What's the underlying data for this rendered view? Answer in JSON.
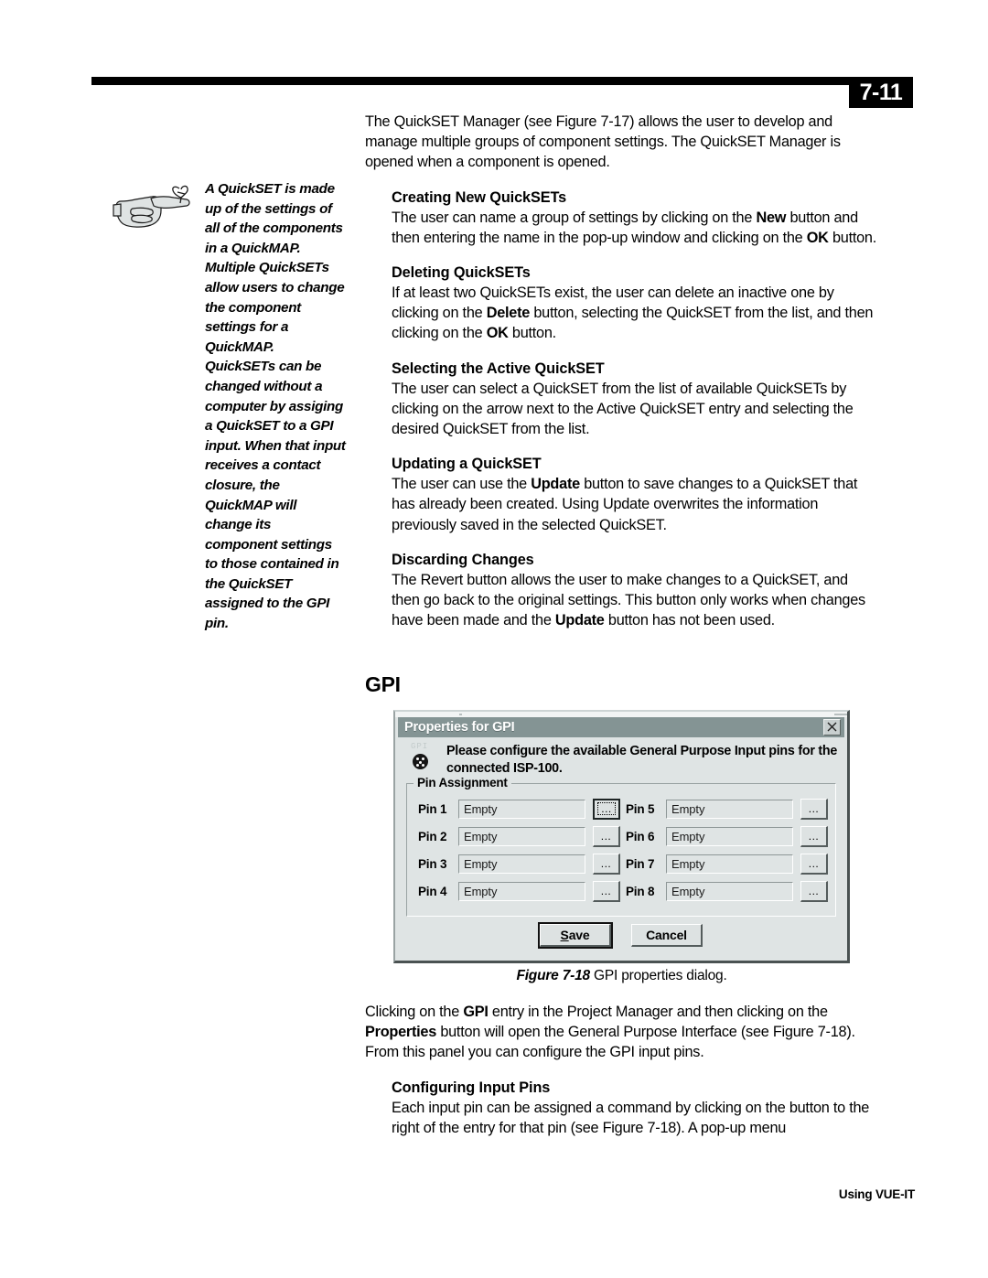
{
  "page": {
    "badge": "7-11",
    "footer": "Using VUE-IT"
  },
  "intro": {
    "paragraph": "The QuickSET Manager (see Figure 7-17) allows the user to develop and manage multiple groups of component settings. The QuickSET Manager is opened when a component is opened."
  },
  "note": {
    "icon": "pointing-hand-icon",
    "text": "A QuickSET is made up of the settings of all of the components in a QuickMAP. Multiple QuickSETs allow users to change the component settings for a QuickMAP. QuickSETs can be changed without a computer by assiging a QuickSET to a GPI input. When that input receives a contact closure, the QuickMAP will change its component settings to those contained in the QuickSET assigned to the GPI pin."
  },
  "sections": [
    {
      "heading": "Creating New QuickSETs",
      "body_html": "The user can name a group of settings by clicking on the <b>New</b> button and then entering the name in the pop-up window and clicking on the <b>OK</b> button."
    },
    {
      "heading": "Deleting QuickSETs",
      "body_html": "If at least two QuickSETs exist, the user can delete an inactive one by clicking on the <b>Delete</b> button, selecting the QuickSET from the list, and then clicking on the <b>OK</b> button."
    },
    {
      "heading": "Selecting the Active QuickSET",
      "body_html": "The user can select a QuickSET from the list of available QuickSETs by clicking on the arrow next to the Active QuickSET entry and selecting the desired QuickSET from the list."
    },
    {
      "heading": "Updating a QuickSET",
      "body_html": "The user can use the <b>Update</b> button to save changes to a QuickSET that has already been created. Using Update overwrites the information previously saved in the selected QuickSET."
    },
    {
      "heading": "Discarding Changes",
      "body_html": "The Revert button allows the user to make changes to a QuickSET, and then go back to the original settings. This button only works when changes have been made and the <b>Update</b> button has not been used."
    }
  ],
  "gpi": {
    "heading": "GPI"
  },
  "dialog": {
    "title": "Properties for GPI",
    "close_icon": "close-icon",
    "icon_label": "GPI",
    "message": "Please configure the available General Purpose Input pins for the connected ISP-100.",
    "group_legend": "Pin Assignment",
    "browse_button_label": "...",
    "pins": [
      {
        "label": "Pin 1",
        "value": "Empty",
        "focused": true
      },
      {
        "label": "Pin 2",
        "value": "Empty",
        "focused": false
      },
      {
        "label": "Pin 3",
        "value": "Empty",
        "focused": false
      },
      {
        "label": "Pin 4",
        "value": "Empty",
        "focused": false
      },
      {
        "label": "Pin 5",
        "value": "Empty",
        "focused": false
      },
      {
        "label": "Pin 6",
        "value": "Empty",
        "focused": false
      },
      {
        "label": "Pin 7",
        "value": "Empty",
        "focused": false
      },
      {
        "label": "Pin 8",
        "value": "Empty",
        "focused": false
      }
    ],
    "save_label_html": "<u>S</u>ave",
    "cancel_label": "Cancel"
  },
  "figure": {
    "caption_label": "Figure 7-18",
    "caption_text": " GPI properties dialog."
  },
  "after_figure": {
    "paragraph_html": "Clicking on the <b>GPI</b> entry in the Project Manager and then clicking on the <b>Properties</b> button will open the General Purpose Interface (see Figure 7-18). From this panel you can configure the GPI input pins."
  },
  "last_section": {
    "heading": "Configuring Input Pins",
    "body_html": "Each input pin can be assigned a command by clicking on the button to the right of the entry for that pin (see Figure 7-18). A pop-up menu"
  }
}
